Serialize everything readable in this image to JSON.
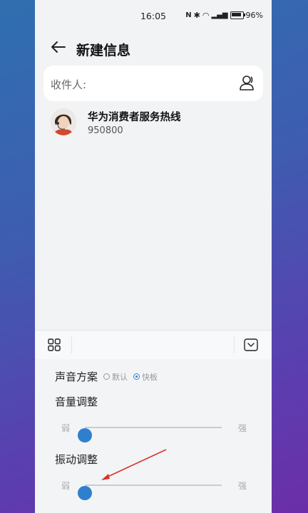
{
  "status": {
    "time": "16:05",
    "signal": "⁴ᴳ",
    "battery": "96%"
  },
  "header": {
    "title": "新建信息"
  },
  "recipient": {
    "label": "收件人:"
  },
  "contact": {
    "name": "华为消费者服务热线",
    "number": "950800"
  },
  "panel": {
    "scheme_label": "声音方案",
    "scheme_options": [
      "默认",
      "快板"
    ],
    "scheme_selected": "快板",
    "volume_title": "音量调整",
    "vibration_title": "振动调整",
    "weak": "弱",
    "strong": "强",
    "volume_level": 0,
    "vibration_level": 0
  },
  "colors": {
    "accent": "#2f7fcf",
    "annotation": "#d9332c"
  }
}
